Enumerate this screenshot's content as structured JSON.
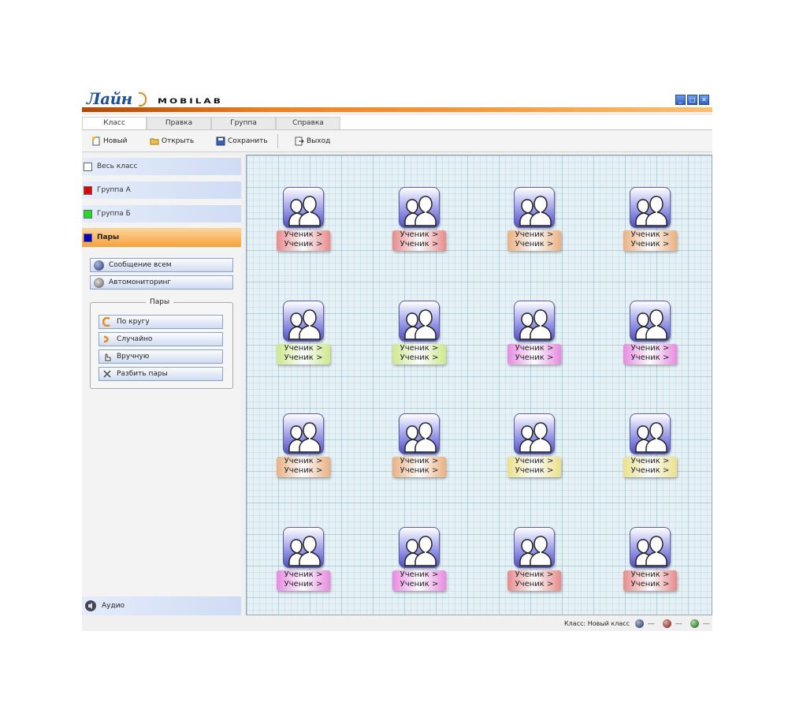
{
  "app": {
    "logo_text": "Лайн",
    "product": "MOBILAB"
  },
  "menu": {
    "tabs": [
      "Класс",
      "Правка",
      "Группа",
      "Справка"
    ]
  },
  "toolbar": {
    "new_label": "Новый",
    "open_label": "Открыть",
    "save_label": "Сохранить",
    "exit_label": "Выход"
  },
  "sidebar": {
    "groups": [
      {
        "label": "Весь класс",
        "color": "#ffffff"
      },
      {
        "label": "Группа А",
        "color": "#e00000"
      },
      {
        "label": "Группа Б",
        "color": "#22dd22"
      },
      {
        "label": "Пары",
        "color": "#0000cc"
      }
    ],
    "message_all_label": "Сообщение всем",
    "automonitoring_label": "Автомониторинг",
    "pairs_legend": "Пары",
    "pair_buttons": [
      "По кругу",
      "Случайно",
      "Вручную",
      "Разбить пары"
    ],
    "audio_label": "Аудио"
  },
  "students": {
    "line1": "Ученик >",
    "line2": "Ученик >",
    "colors": [
      "#e88a8a",
      "#e88a8a",
      "#eab080",
      "#eab080",
      "#cfe88a",
      "#cfe88a",
      "#e88ae0",
      "#e88ae0",
      "#eab080",
      "#eab080",
      "#eae08a",
      "#eae08a",
      "#e88ae0",
      "#e88ae0",
      "#e88a8a",
      "#e88a8a"
    ]
  },
  "status": {
    "class_text": "Класс: Новый класс",
    "indicators": [
      "---",
      "---",
      "---"
    ]
  }
}
